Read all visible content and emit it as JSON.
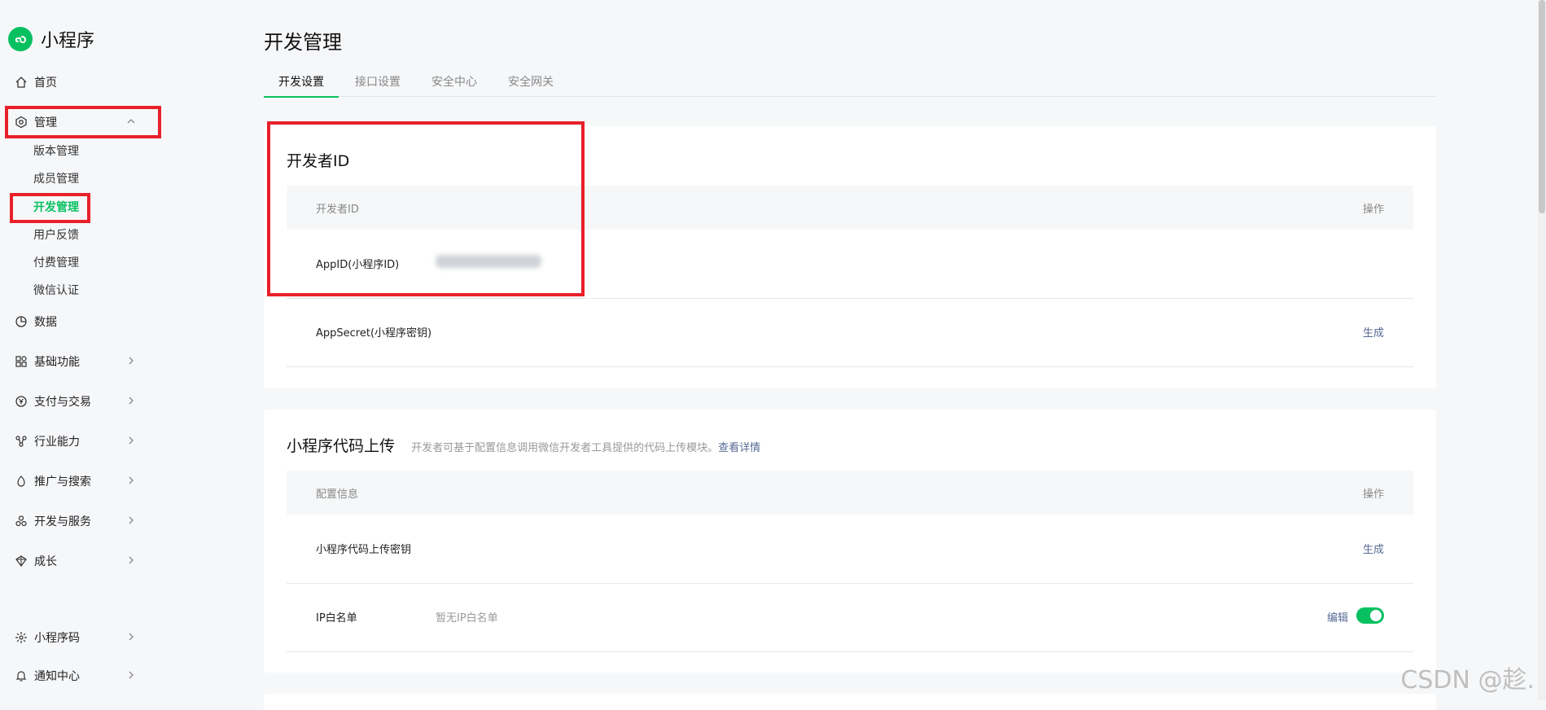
{
  "brand": {
    "name": "小程序",
    "logo_icon": "mini-program-logo-icon",
    "color": "#07c160"
  },
  "sidebar": {
    "items": [
      {
        "key": "home",
        "label": "首页",
        "icon": "home-icon"
      },
      {
        "key": "manage",
        "label": "管理",
        "icon": "manage-icon",
        "expanded": true,
        "children": [
          {
            "label": "版本管理"
          },
          {
            "label": "成员管理"
          },
          {
            "label": "开发管理",
            "active": true
          },
          {
            "label": "用户反馈"
          },
          {
            "label": "付费管理"
          },
          {
            "label": "微信认证"
          }
        ]
      },
      {
        "key": "data",
        "label": "数据",
        "icon": "data-icon"
      },
      {
        "key": "basic",
        "label": "基础功能",
        "icon": "grid-icon"
      },
      {
        "key": "pay",
        "label": "支付与交易",
        "icon": "yuan-icon"
      },
      {
        "key": "industry",
        "label": "行业能力",
        "icon": "industry-icon"
      },
      {
        "key": "promo",
        "label": "推广与搜索",
        "icon": "promo-icon"
      },
      {
        "key": "devservice",
        "label": "开发与服务",
        "icon": "dev-service-icon"
      },
      {
        "key": "growth",
        "label": "成长",
        "icon": "growth-icon"
      },
      {
        "key": "qrcode",
        "label": "小程序码",
        "icon": "qrcode-icon"
      },
      {
        "key": "notify",
        "label": "通知中心",
        "icon": "bell-icon"
      }
    ]
  },
  "page": {
    "title": "开发管理",
    "tabs": [
      {
        "label": "开发设置",
        "active": true
      },
      {
        "label": "接口设置"
      },
      {
        "label": "安全中心"
      },
      {
        "label": "安全网关"
      }
    ]
  },
  "dev_id_card": {
    "title": "开发者ID",
    "header": {
      "col1": "开发者ID",
      "col2": "操作"
    },
    "rows": [
      {
        "label": "AppID(小程序ID)",
        "value_blurred": true
      },
      {
        "label": "AppSecret(小程序密钥)",
        "action": "生成"
      }
    ]
  },
  "upload_card": {
    "title": "小程序代码上传",
    "subtitle": "开发者可基于配置信息调用微信开发者工具提供的代码上传模块。",
    "link": "查看详情",
    "header": {
      "col1": "配置信息",
      "col2": "操作"
    },
    "rows": [
      {
        "label": "小程序代码上传密钥",
        "action": "生成"
      },
      {
        "label": "IP白名单",
        "value": "暂无IP白名单",
        "action": "编辑",
        "toggle_on": true
      }
    ]
  },
  "watermark": "CSDN @趁.",
  "colors": {
    "accent": "#07c160",
    "link": "#576b95",
    "highlight": "#e8202a"
  }
}
